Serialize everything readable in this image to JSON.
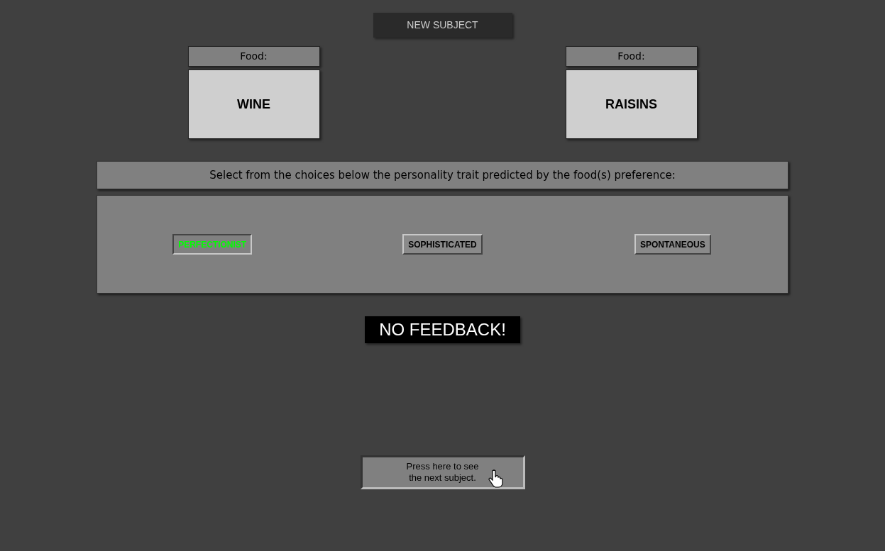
{
  "new_subject_button": "NEW SUBJECT",
  "foods": [
    {
      "label": "Food:",
      "value": "WINE"
    },
    {
      "label": "Food:",
      "value": "RAISINS"
    }
  ],
  "prompt": "Select from the choices below the personality trait predicted by the food(s) preference:",
  "choices": [
    {
      "label": "PERFECTIONIST",
      "selected": true
    },
    {
      "label": "SOPHISTICATED",
      "selected": false
    },
    {
      "label": "SPONTANEOUS",
      "selected": false
    }
  ],
  "feedback": "NO FEEDBACK!",
  "next_button": "Press here to see the next subject."
}
